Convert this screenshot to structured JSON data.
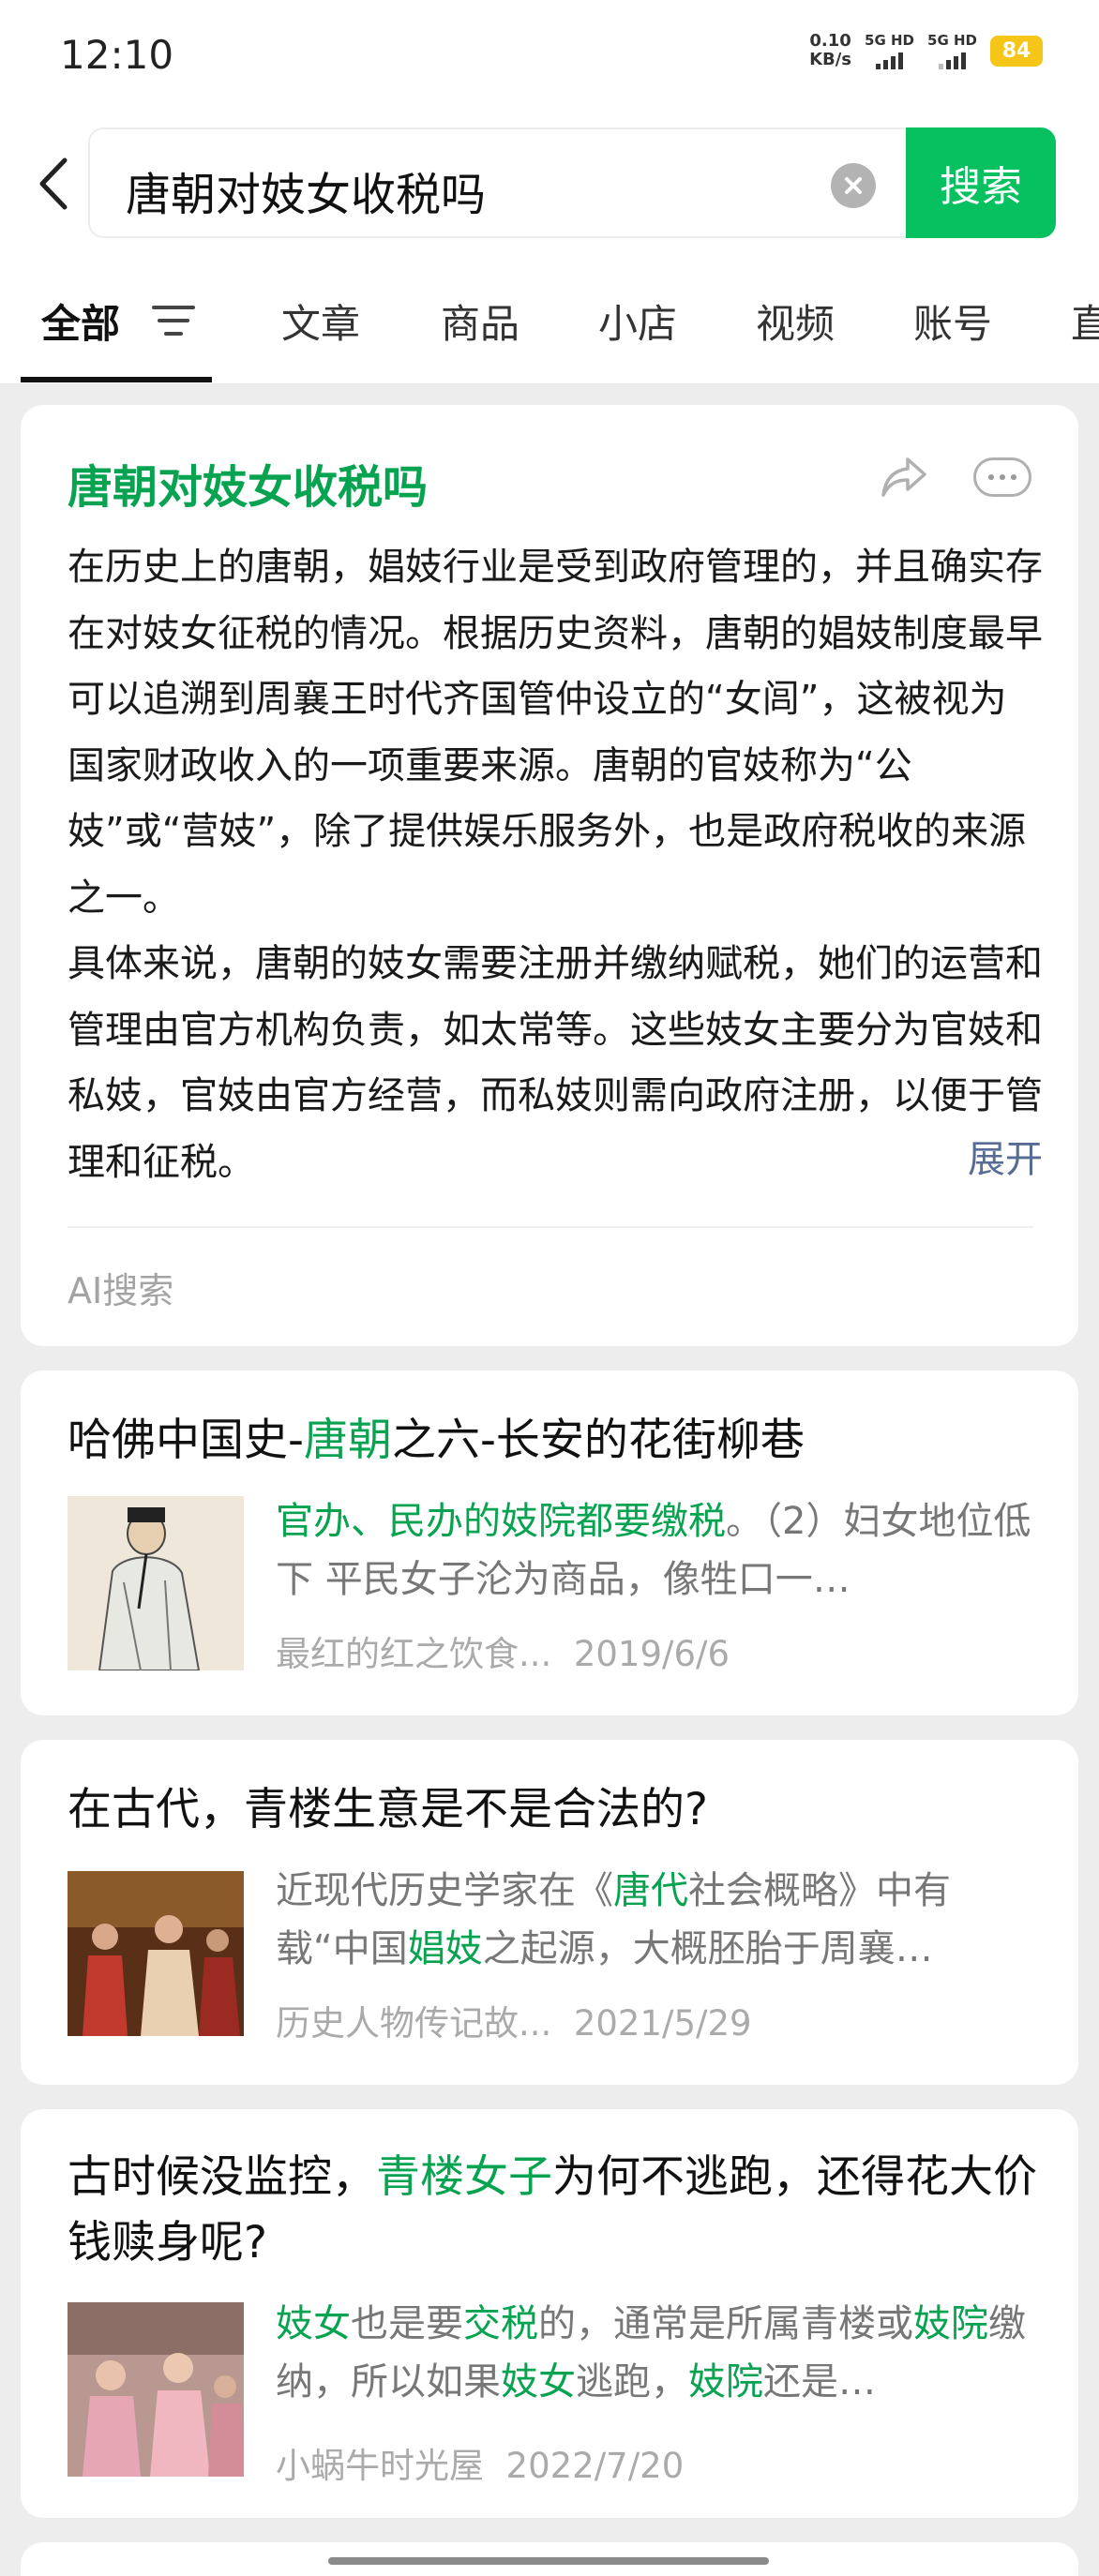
{
  "status": {
    "time": "12:10",
    "speed_value": "0.10",
    "speed_unit": "KB/s",
    "sim1": "5G HD",
    "sim2": "5G HD",
    "battery": "84"
  },
  "search": {
    "query": "唐朝对妓女收税吗",
    "button_label": "搜索"
  },
  "tabs": [
    {
      "label": "全部"
    },
    {
      "label": "文章"
    },
    {
      "label": "商品"
    },
    {
      "label": "小店"
    },
    {
      "label": "视频"
    },
    {
      "label": "账号"
    },
    {
      "label": "直"
    }
  ],
  "ai_card": {
    "title": "唐朝对妓女收税吗",
    "paragraph1": "在历史上的唐朝，娼妓行业是受到政府管理的，并且确实存在对妓女征税的情况。根据历史资料，唐朝的娼妓制度最早可以追溯到周襄王时代齐国管仲设立的“女闾”，这被视为国家财政收入的一项重要来源。唐朝的官妓称为“公妓”或“营妓”，除了提供娱乐服务外，也是政府税收的来源之一。",
    "paragraph2": "具体来说，唐朝的妓女需要注册并缴纳赋税，她们的运营和管理由官方机构负责，如太常等。这些妓女主要分为官妓和私妓，官妓由官方经营，而私妓则需向政府注册，以便于管理和征税。",
    "expand_label": "展开",
    "source_label": "AI搜索"
  },
  "results": [
    {
      "title_parts": [
        "哈佛中国史-",
        "唐朝",
        "之六-长安的花街柳巷"
      ],
      "snippet_parts": [
        "官办、民办的妓院都要缴税",
        "。（2）妇女地位低下 平民女子沦为商品，像牲口一…"
      ],
      "source": "最红的红之饮食...",
      "date": "2019/6/6",
      "thumb_icon": "tang-scholar-painting"
    },
    {
      "title": "在古代，青楼生意是不是合法的?",
      "snippet_parts": [
        "近现代历史学家在《",
        "唐代",
        "社会概略》中有载“中国",
        "娼妓",
        "之起源，大概胚胎于周襄…"
      ],
      "source": "历史人物传记故...",
      "date": "2021/5/29",
      "thumb_icon": "drama-scene-still"
    },
    {
      "title_parts": [
        "古时候没监控，",
        "青楼女子",
        "为何不逃跑，还得花大价钱赎身呢?"
      ],
      "snippet_parts": [
        "妓女",
        "也是要",
        "交税",
        "的，通常是所属青楼或",
        "妓院",
        "缴纳，所以如果",
        "妓女",
        "逃跑，",
        "妓院",
        "还是…"
      ],
      "source": "小蜗牛时光屋",
      "date": "2022/7/20",
      "thumb_icon": "costume-drama-still"
    }
  ],
  "colors": {
    "accent": "#07c160",
    "highlight": "#07a351",
    "link": "#576b95",
    "background": "#ededed"
  }
}
